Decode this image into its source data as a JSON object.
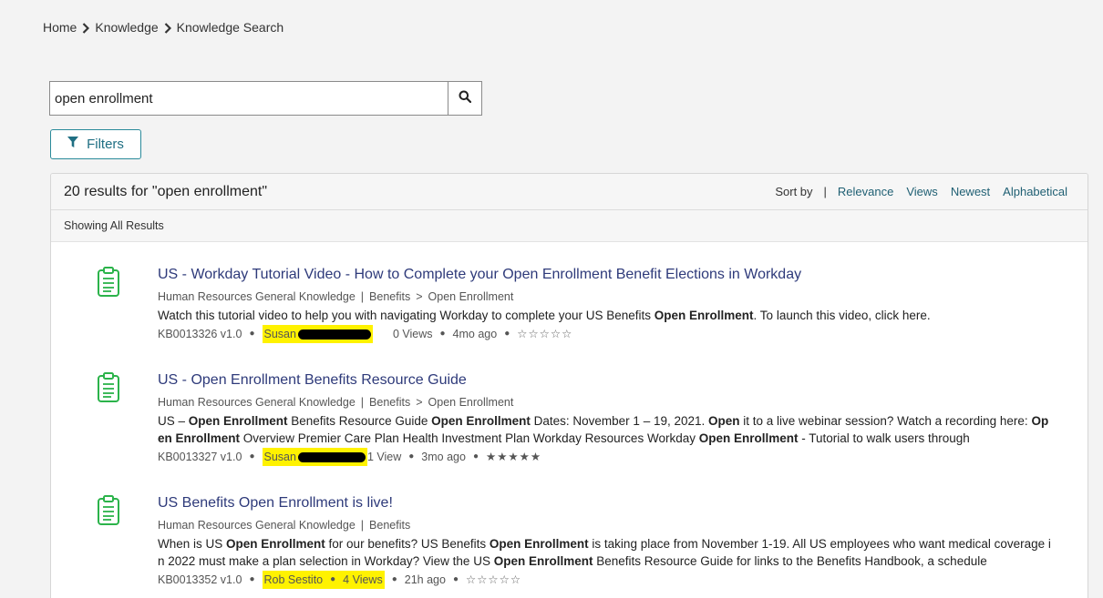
{
  "breadcrumb": {
    "items": [
      "Home",
      "Knowledge",
      "Knowledge Search"
    ]
  },
  "search": {
    "value": "open enrollment"
  },
  "filters": {
    "label": "Filters"
  },
  "results_header": {
    "count_text": "20 results for \"open enrollment\"",
    "sort_label": "Sort by",
    "sort_separator": "|",
    "sort_options": [
      "Relevance",
      "Views",
      "Newest",
      "Alphabetical"
    ],
    "showing": "Showing All Results"
  },
  "results": [
    {
      "title": "US - Workday Tutorial Video - How to Complete your Open Enrollment Benefit Elections in Workday",
      "kb": "Human Resources General Knowledge",
      "category": "Benefits",
      "subcategory": "Open Enrollment",
      "snippet_parts": [
        {
          "t": "Watch this tutorial video to help you with navigating Workday to complete your US Benefits ",
          "b": false
        },
        {
          "t": "Open Enrollment",
          "b": true
        },
        {
          "t": ". To launch this video, click here.",
          "b": false
        }
      ],
      "number": "KB0013326 v1.0",
      "author": "Susan",
      "views": "0 Views",
      "age": "4mo ago",
      "stars": "☆☆☆☆☆"
    },
    {
      "title": "US - Open Enrollment Benefits Resource Guide",
      "kb": "Human Resources General Knowledge",
      "category": "Benefits",
      "subcategory": "Open Enrollment",
      "snippet_parts": [
        {
          "t": "US – ",
          "b": false
        },
        {
          "t": "Open Enrollment",
          "b": true
        },
        {
          "t": " Benefits Resource Guide ",
          "b": false
        },
        {
          "t": "Open Enrollment",
          "b": true
        },
        {
          "t": " Dates: November 1 – 19, 2021. ",
          "b": false
        },
        {
          "t": "Open",
          "b": true
        },
        {
          "t": " it to a live webinar session? Watch a recording here: ",
          "b": false
        },
        {
          "t": "Open Enrollment",
          "b": true
        },
        {
          "t": " Overview Premier Care Plan Health Investment Plan   Workday Resources Workday ",
          "b": false
        },
        {
          "t": "Open Enrollment",
          "b": true
        },
        {
          "t": " - Tutorial to walk users through",
          "b": false
        }
      ],
      "number": "KB0013327 v1.0",
      "author": "Susan",
      "views": "1 View",
      "age": "3mo ago",
      "stars": "★★★★★"
    },
    {
      "title": "US Benefits Open Enrollment is live!",
      "kb": "Human Resources General Knowledge",
      "category": "Benefits",
      "subcategory": "",
      "snippet_parts": [
        {
          "t": "When is US ",
          "b": false
        },
        {
          "t": "Open Enrollment",
          "b": true
        },
        {
          "t": " for our benefits? US Benefits ",
          "b": false
        },
        {
          "t": "Open Enrollment",
          "b": true
        },
        {
          "t": " is taking place from November 1-19. All US employees who want medical coverage in 2022 must make a plan selection in Workday? View the US ",
          "b": false
        },
        {
          "t": "Open Enrollment",
          "b": true
        },
        {
          "t": " Benefits Resource Guide for links to the Benefits Handbook, a schedule",
          "b": false
        }
      ],
      "number": "KB0013352 v1.0",
      "author": "Rob Sestito",
      "views": "4 Views",
      "age": "21h ago",
      "stars": "☆☆☆☆☆"
    }
  ],
  "colors": {
    "accent": "#1f6f83",
    "title": "#2e3a7a",
    "doc_icon": "#2bb34a",
    "highlight": "#fff200"
  },
  "icons": {
    "search": "search-icon",
    "filter": "filter-icon",
    "chevron": "chevron-right-icon",
    "doc": "document-icon"
  }
}
